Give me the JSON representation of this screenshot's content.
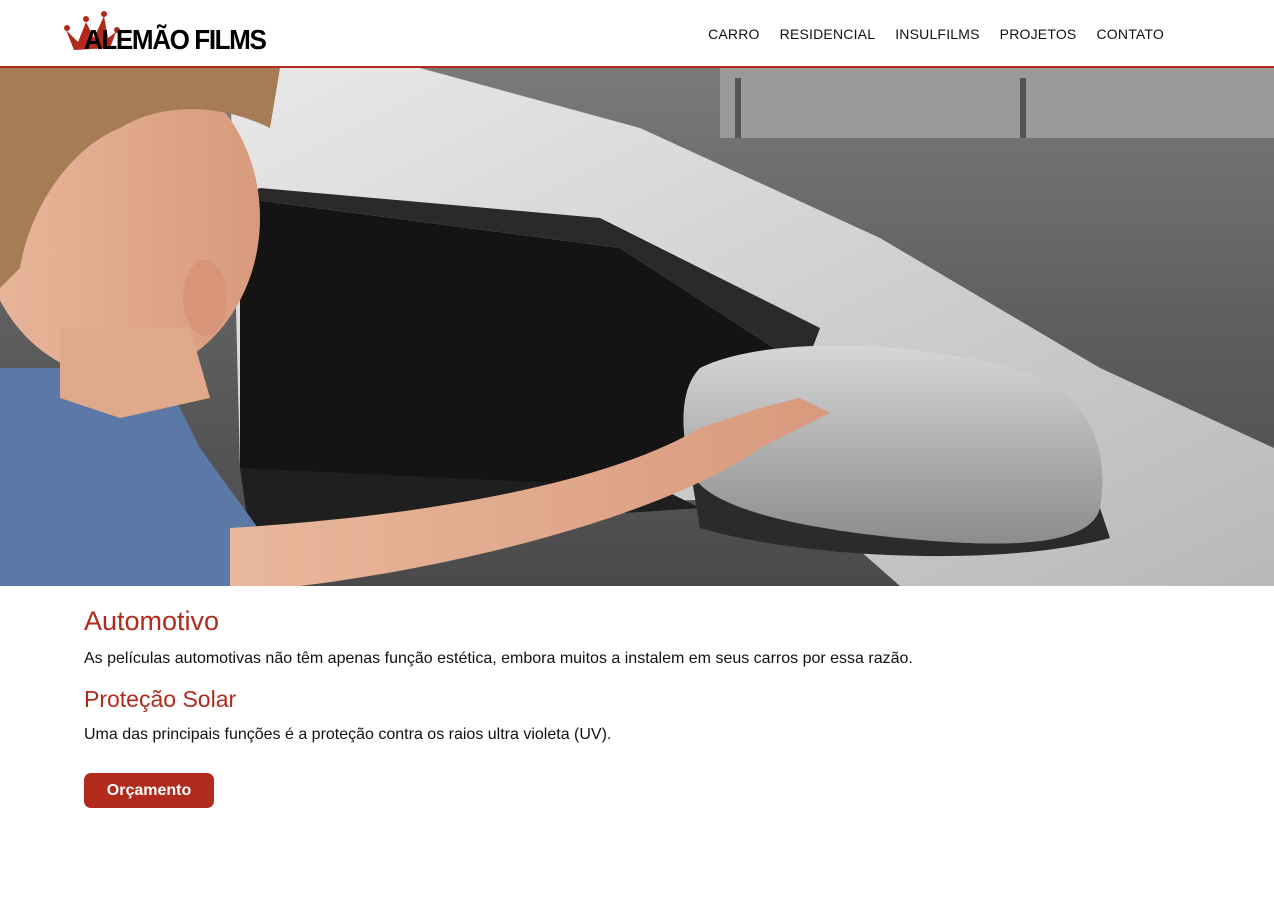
{
  "brand": {
    "name": "ALEMÃO FILMS",
    "accent_color": "#b22a1c",
    "logo_icon": "crown-icon"
  },
  "nav": {
    "items": [
      {
        "label": "CARRO"
      },
      {
        "label": "RESIDENCIAL"
      },
      {
        "label": "INSULFILMS"
      },
      {
        "label": "PROJETOS"
      },
      {
        "label": "CONTATO"
      }
    ]
  },
  "hero": {
    "image": "man applying window tint film to car window"
  },
  "section": {
    "title": "Automotivo",
    "description": "As películas automotivas não têm apenas função estética, embora muitos a instalem em seus carros por essa razão.",
    "subtitle": "Proteção Solar",
    "subtitle_description": "Uma das principais funções é a proteção contra os raios ultra violeta (UV).",
    "cta_label": "Orçamento"
  }
}
